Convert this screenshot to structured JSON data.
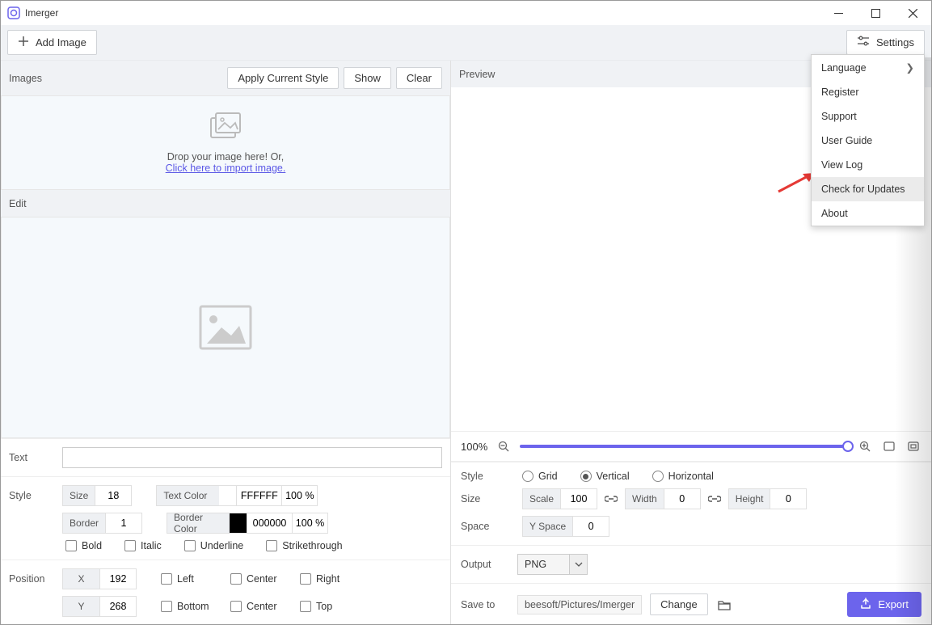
{
  "window": {
    "title": "Imerger"
  },
  "toolbar": {
    "add_image": "Add Image",
    "settings": "Settings"
  },
  "images": {
    "header": "Images",
    "apply": "Apply Current Style",
    "show": "Show",
    "clear": "Clear",
    "drop_line1": "Drop your image here! Or,",
    "drop_link": "Click here to import image."
  },
  "edit": {
    "header": "Edit"
  },
  "text": {
    "label": "Text",
    "value": ""
  },
  "style": {
    "label": "Style",
    "size_label": "Size",
    "size": "18",
    "textcolor_label": "Text Color",
    "textcolor": "FFFFFF",
    "textcolor_pct": "100 %",
    "border_label": "Border",
    "border": "1",
    "bordercolor_label": "Border Color",
    "bordercolor": "000000",
    "bordercolor_pct": "100 %",
    "bold": "Bold",
    "italic": "Italic",
    "underline": "Underline",
    "strike": "Strikethrough"
  },
  "position": {
    "label": "Position",
    "x_label": "X",
    "x": "192",
    "y_label": "Y",
    "y": "268",
    "left": "Left",
    "centerx": "Center",
    "right": "Right",
    "bottom": "Bottom",
    "centery": "Center",
    "top": "Top"
  },
  "preview": {
    "header": "Preview",
    "zoom": "100%",
    "style_label": "Style",
    "grid": "Grid",
    "vertical": "Vertical",
    "horizontal": "Horizontal",
    "size_label": "Size",
    "scale_label": "Scale",
    "scale": "100",
    "width_label": "Width",
    "width": "0",
    "height_label": "Height",
    "height": "0",
    "space_label": "Space",
    "yspace_label": "Y Space",
    "yspace": "0",
    "output_label": "Output",
    "output": "PNG",
    "saveto_label": "Save to",
    "path": "beesoft/Pictures/Imerger",
    "change": "Change",
    "export": "Export"
  },
  "settings_menu": {
    "language": "Language",
    "register": "Register",
    "support": "Support",
    "user_guide": "User Guide",
    "view_log": "View Log",
    "check_updates": "Check for Updates",
    "about": "About"
  }
}
